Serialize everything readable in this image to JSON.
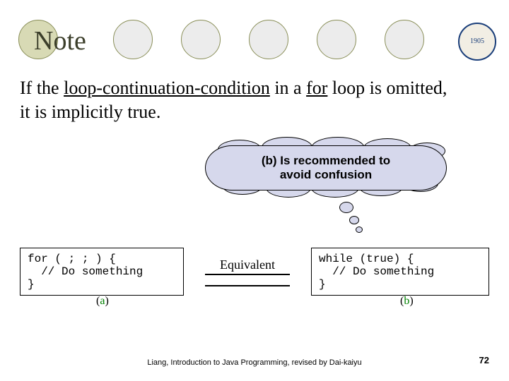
{
  "title": "Note",
  "logo_year": "1905",
  "body": {
    "pre": "If the ",
    "u1": "loop-continuation-condition",
    "mid": " in a ",
    "u2": "for",
    "post1": " loop is omitted,",
    "post2": "it is implicitly true."
  },
  "callout": {
    "line1": "(b) Is recommended to",
    "line2": "avoid confusion"
  },
  "code": {
    "a": "for ( ; ; ) {\n  // Do something\n}",
    "equiv_label": "Equivalent",
    "b": "while (true) {\n  // Do something\n}"
  },
  "captions": {
    "a_open": "(",
    "a_letter": "a",
    "a_close": ")",
    "b_open": "(",
    "b_letter": "b",
    "b_close": ")"
  },
  "footer": "Liang, Introduction to Java Programming, revised by Dai-kaiyu",
  "page": "72"
}
